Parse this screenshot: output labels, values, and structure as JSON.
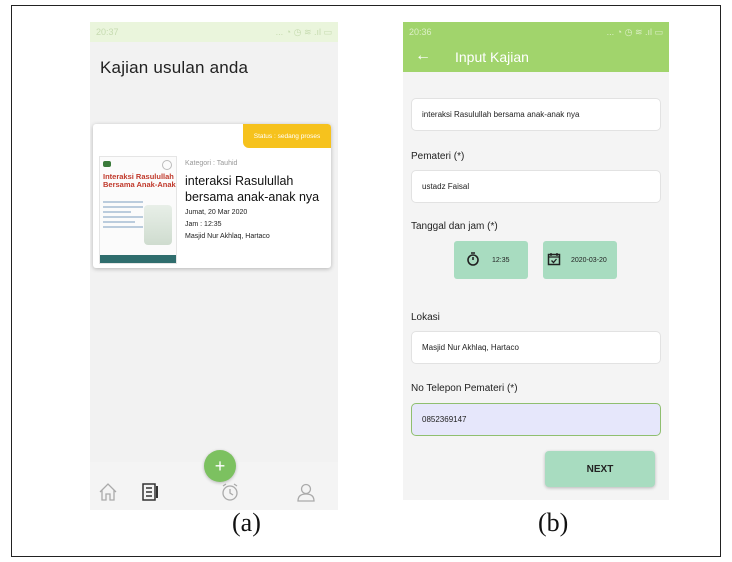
{
  "screen_a": {
    "status_time": "20:37",
    "status_icons": "... ◔ ◷ ≋ .ıl ▭",
    "title": "Kajian usulan anda",
    "card": {
      "status": "Status : sedang proses",
      "category": "Kategori : Tauhid",
      "title": "interaksi Rasulullah bersama anak-anak nya",
      "date": "Jumat, 20 Mar 2020",
      "time": "Jam : 12:35",
      "place": "Masjid Nur Akhlaq, Hartaco",
      "poster_title": "Interaksi Rasulullah Bersama Anak-Anak"
    },
    "fab_label": "+"
  },
  "screen_b": {
    "status_time": "20:36",
    "status_icons": "... ◔ ◷ ≋ .ıl ▭",
    "appbar_title": "Input Kajian",
    "judul_value": "interaksi Rasulullah bersama anak-anak nya",
    "pemateri_label": "Pemateri (*)",
    "pemateri_value": "ustadz Faisal",
    "tanggal_label": "Tanggal dan jam (*)",
    "time_value": "12:35",
    "date_value": "2020-03-20",
    "lokasi_label": "Lokasi",
    "lokasi_value": "Masjid Nur Akhlaq, Hartaco",
    "telepon_label": "No Telepon Pemateri (*)",
    "telepon_value": "0852369147",
    "next_label": "NEXT"
  },
  "captions": {
    "a": "(a)",
    "b": "(b)"
  },
  "colors": {
    "green": "#a1d46c",
    "mint": "#a8dcc0",
    "badge": "#f6c21d",
    "fab": "#7cc160"
  }
}
